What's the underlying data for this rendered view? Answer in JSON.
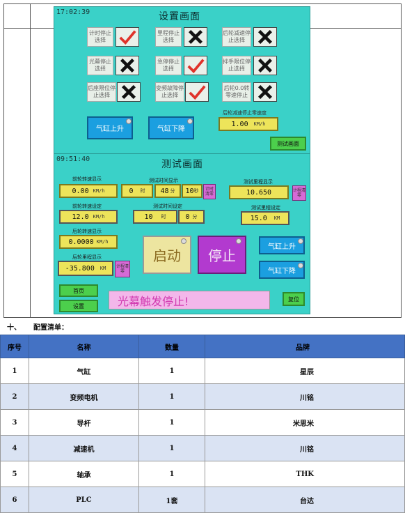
{
  "screen1": {
    "time": "17:02:39",
    "title": "设置画面",
    "options": [
      {
        "label": "计时停止选择",
        "state": "check"
      },
      {
        "label": "里程停止选择",
        "state": "x"
      },
      {
        "label": "后轮减速停止选择",
        "state": "x"
      },
      {
        "label": "光幕停止选择",
        "state": "x"
      },
      {
        "label": "急停停止选择",
        "state": "check"
      },
      {
        "label": "拌手限位停止选择",
        "state": "x"
      },
      {
        "label": "后座限位停止选择",
        "state": "x"
      },
      {
        "label": "变频故障停止选择",
        "state": "check"
      },
      {
        "label": "后轮0.0转零速停止",
        "state": "x"
      }
    ],
    "cyl_up": "气缸上升",
    "cyl_down": "气缸下降",
    "rear_slow_label": "后轮减速停止零速度",
    "rear_slow_value": "1.00",
    "rear_slow_unit": "KM/h",
    "test_screen_btn": "测试画面"
  },
  "screen2": {
    "time": "09:51:40",
    "title": "测试画面",
    "front_speed_label": "前轮转速显示",
    "front_speed_value": "0.00",
    "front_speed_unit": "KM/h",
    "test_time_label": "测试时间显示",
    "time_h": "0",
    "time_h_unit": "时",
    "time_m": "48",
    "time_m_unit": "分",
    "time_s": "10",
    "time_s_unit": "秒",
    "timer_clear": "计时清零",
    "test_mileage_label": "测试里程显示",
    "test_mileage_value": "10.650",
    "mileage_clear": "计程清零",
    "front_speed_set_label": "前轮转速设定",
    "front_speed_set_value": "12.0",
    "front_speed_set_unit": "KM/h",
    "test_time_set_label": "测试时间设定",
    "time_set_h": "10",
    "time_set_h_unit": "时",
    "time_set_m": "0",
    "time_set_m_unit": "分",
    "mileage_set_label": "测试里程设定",
    "mileage_set_value": "15.0",
    "mileage_set_unit": "KM",
    "rear_speed_label": "后轮转速显示",
    "rear_speed_value": "0.0000",
    "rear_speed_unit": "KM/h",
    "rear_mileage_label": "后轮里程显示",
    "rear_mileage_value": "-35.800",
    "rear_mileage_unit": "KM",
    "rear_clear": "计程清零",
    "start": "启动",
    "stop": "停止",
    "cyl_up": "气缸上升",
    "cyl_down": "气缸下降",
    "home": "首页",
    "settings": "设置",
    "message": "光幕触发停止!",
    "reset": "复位"
  },
  "heading": {
    "num": "十、",
    "text": "配置清单："
  },
  "table": {
    "headers": [
      "序号",
      "名称",
      "数量",
      "品牌"
    ],
    "rows": [
      [
        "1",
        "气缸",
        "1",
        "星辰"
      ],
      [
        "2",
        "变频电机",
        "1",
        "川铭"
      ],
      [
        "3",
        "导杆",
        "1",
        "米思米"
      ],
      [
        "4",
        "减速机",
        "1",
        "川铭"
      ],
      [
        "5",
        "轴承",
        "1",
        "THK"
      ],
      [
        "6",
        "PLC",
        "1套",
        "台达"
      ]
    ]
  },
  "colors": {
    "screen_bg": "#3ad1c8",
    "table_header": "#4472c4",
    "table_alt_row": "#dae3f3",
    "check_red": "#e0322a"
  }
}
